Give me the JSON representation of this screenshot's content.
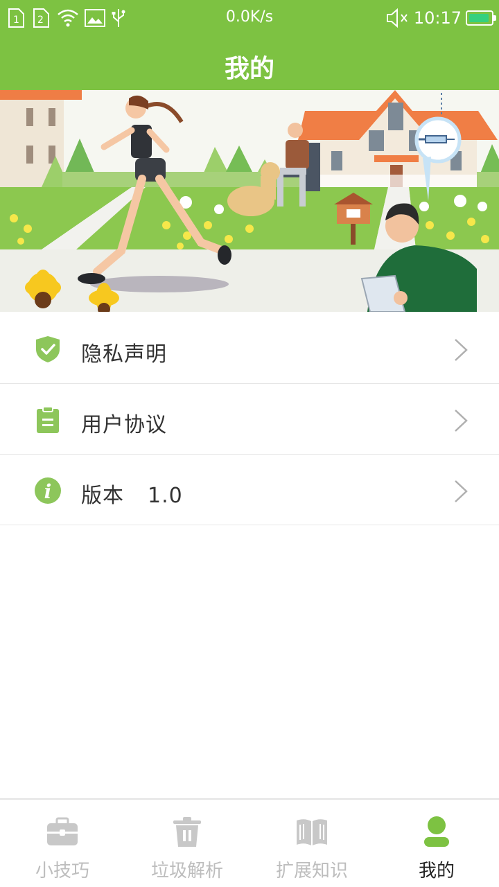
{
  "status_bar": {
    "speed": "0.0K/s",
    "time": "10:17",
    "sim1": "1",
    "sim2": "2",
    "icons": [
      "sim1-icon",
      "sim2-icon",
      "wifi-icon",
      "image-icon",
      "usb-icon",
      "mute-icon",
      "battery-icon"
    ]
  },
  "header": {
    "title": "我的"
  },
  "banner": {
    "icon": "banner-illustration"
  },
  "menu": {
    "items": [
      {
        "label": "隐私声明",
        "icon": "shield-check-icon"
      },
      {
        "label": "用户协议",
        "icon": "clipboard-icon"
      },
      {
        "label": "版本",
        "value": "1.0",
        "icon": "info-icon"
      }
    ]
  },
  "bottom_nav": {
    "tabs": [
      {
        "label": "小技巧",
        "icon": "toolbox-icon",
        "active": false
      },
      {
        "label": "垃圾解析",
        "icon": "trash-icon",
        "active": false
      },
      {
        "label": "扩展知识",
        "icon": "book-icon",
        "active": false
      },
      {
        "label": "我的",
        "icon": "user-icon",
        "active": true
      }
    ]
  },
  "colors": {
    "accent": "#7dc242",
    "inactive": "#bdbdbd",
    "active_text": "#222222"
  }
}
